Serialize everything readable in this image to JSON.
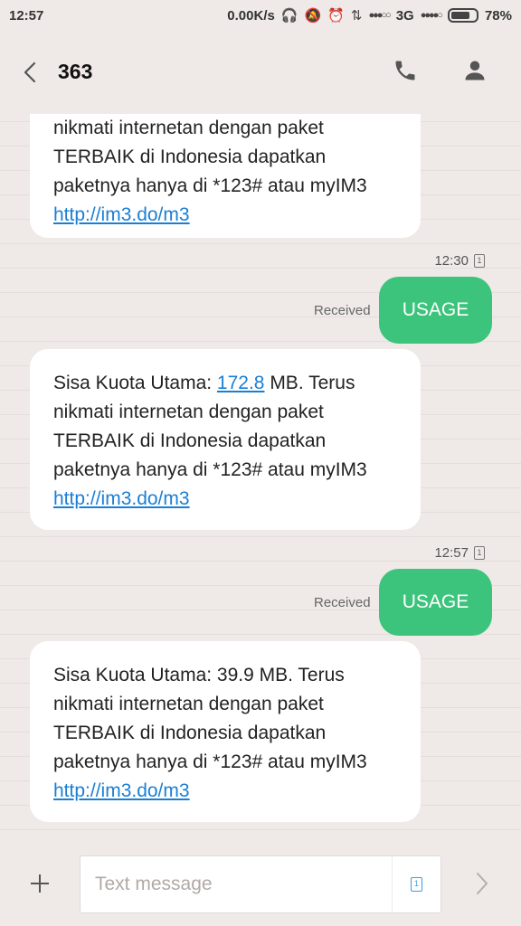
{
  "status_bar": {
    "time": "12:57",
    "speed": "0.00K/s",
    "network": "3G",
    "battery": "78%",
    "battery_level": 0.78
  },
  "header": {
    "title": "363",
    "icons": {
      "back": "back-arrow-icon",
      "call": "phone-icon",
      "contact": "person-icon"
    }
  },
  "messages": [
    {
      "direction": "incoming",
      "lines": [
        "nikmati internetan dengan paket",
        "TERBAIK di Indonesia dapatkan",
        "paketnya hanya di *123# atau  myIM3"
      ],
      "link": "http://im3.do/m3"
    },
    {
      "direction": "outgoing",
      "time": "12:30",
      "sim": "1",
      "status": "Received",
      "text": "USAGE"
    },
    {
      "direction": "incoming",
      "prefix": "Sisa Kuota Utama: ",
      "value": "172.8",
      "suffix": " MB. Terus",
      "lines": [
        "nikmati internetan dengan paket",
        "TERBAIK di Indonesia dapatkan",
        "paketnya hanya di *123# atau  myIM3"
      ],
      "link": "http://im3.do/m3"
    },
    {
      "direction": "outgoing",
      "time": "12:57",
      "sim": "1",
      "status": "Received",
      "text": "USAGE"
    },
    {
      "direction": "incoming",
      "first_line": "Sisa Kuota Utama: 39.9 MB. Terus",
      "lines": [
        "nikmati internetan dengan paket",
        "TERBAIK di Indonesia dapatkan",
        "paketnya hanya di *123# atau  myIM3"
      ],
      "link": "http://im3.do/m3"
    }
  ],
  "composer": {
    "placeholder": "Text message",
    "value": "",
    "sim": "1"
  },
  "colors": {
    "background": "#efeae7",
    "outgoing_bubble": "#3cc47c",
    "link": "#1a7fd4"
  }
}
